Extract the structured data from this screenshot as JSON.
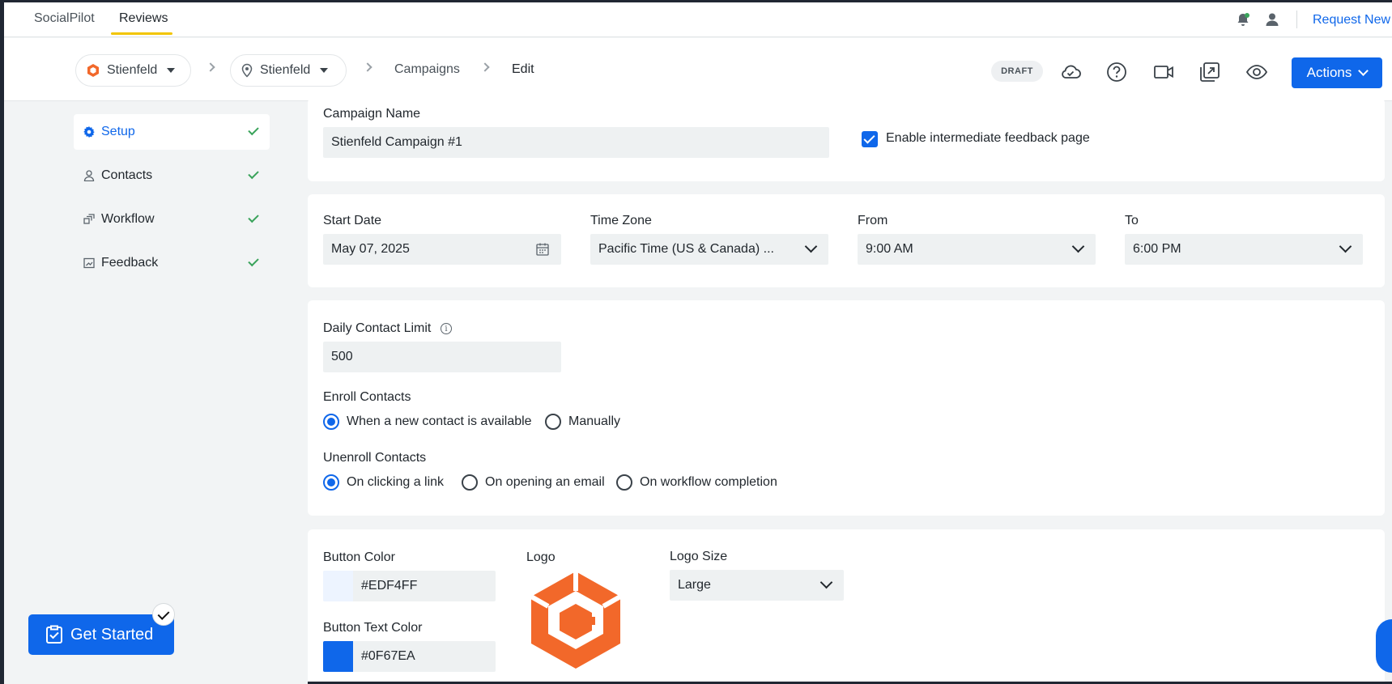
{
  "topbar": {
    "tabs": [
      {
        "label": "SocialPilot",
        "active": false
      },
      {
        "label": "Reviews",
        "active": true
      }
    ],
    "request_link": "Request New F"
  },
  "breadcrumb": {
    "brand": "Stienfeld",
    "location": "Stienfeld",
    "campaigns": "Campaigns",
    "current": "Edit"
  },
  "toolbar": {
    "status_badge": "DRAFT",
    "actions_label": "Actions",
    "icons": [
      "cloud-check-icon",
      "help-icon",
      "video-icon",
      "share-icon",
      "preview-eye-icon"
    ]
  },
  "sidebar": {
    "items": [
      {
        "label": "Setup",
        "icon": "gear-icon",
        "active": true,
        "done": true
      },
      {
        "label": "Contacts",
        "icon": "person-icon",
        "active": false,
        "done": true
      },
      {
        "label": "Workflow",
        "icon": "workflow-icon",
        "active": false,
        "done": true
      },
      {
        "label": "Feedback",
        "icon": "feedback-icon",
        "active": false,
        "done": true
      }
    ]
  },
  "campaign": {
    "name_label": "Campaign Name",
    "name_value": "Stienfeld Campaign #1",
    "feedback_page_label": "Enable intermediate feedback page",
    "feedback_page_checked": true
  },
  "schedule": {
    "start_date_label": "Start Date",
    "start_date_value": "May 07, 2025",
    "timezone_label": "Time Zone",
    "timezone_value": "Pacific Time (US & Canada) ...",
    "from_label": "From",
    "from_value": "9:00 AM",
    "to_label": "To",
    "to_value": "6:00 PM"
  },
  "limits": {
    "daily_limit_label": "Daily Contact Limit",
    "daily_limit_value": "500",
    "enroll_label": "Enroll Contacts",
    "enroll_options": [
      {
        "label": "When a new contact is available",
        "selected": true
      },
      {
        "label": "Manually",
        "selected": false
      }
    ],
    "unenroll_label": "Unenroll Contacts",
    "unenroll_options": [
      {
        "label": "On clicking a link",
        "selected": true
      },
      {
        "label": "On opening an email",
        "selected": false
      },
      {
        "label": "On workflow completion",
        "selected": false
      }
    ]
  },
  "branding": {
    "button_color_label": "Button Color",
    "button_color_value": "#EDF4FF",
    "button_text_color_label": "Button Text Color",
    "button_text_color_value": "#0F67EA",
    "logo_label": "Logo",
    "logo_size_label": "Logo Size",
    "logo_size_value": "Large"
  },
  "get_started": {
    "label": "Get Started"
  },
  "colors": {
    "accent": "#0F67EA",
    "logo_orange": "#F2682A",
    "check_green": "#3AA35B",
    "tab_underline": "#F2C500"
  }
}
